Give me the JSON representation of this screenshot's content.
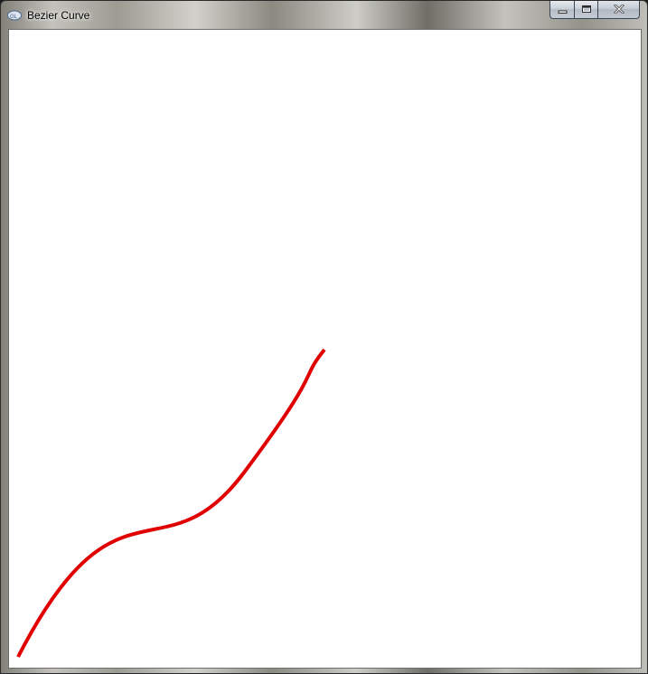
{
  "window": {
    "title": "Bezier Curve",
    "app_icon": "glut-app-icon",
    "controls": {
      "minimize_icon": "minimize-icon",
      "maximize_icon": "maximize-icon",
      "close_icon": "close-icon"
    }
  },
  "canvas": {
    "background": "#ffffff",
    "curve_color": "#e00000",
    "curve_type": "cubic-bezier"
  }
}
